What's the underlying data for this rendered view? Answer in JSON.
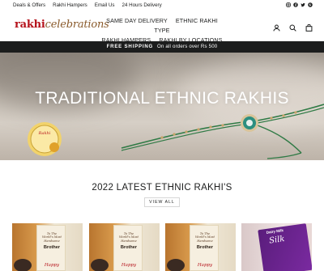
{
  "utility_bar": {
    "links": [
      "Deals & Offers",
      "Rakhi Hampers",
      "Email Us",
      "24 Hours Delivery"
    ],
    "social_icons": [
      "instagram-icon",
      "facebook-icon",
      "twitter-icon",
      "pinterest-icon"
    ]
  },
  "header": {
    "logo_prefix": "rakhi",
    "logo_suffix": "celebrations",
    "nav": [
      "SAME DAY DELIVERY",
      "ETHNIC RAKHI",
      "TYPE",
      "RAKHI HAMPERS",
      "RAKHI BY LOCATIONS"
    ],
    "icons": [
      "user-icon",
      "search-icon",
      "cart-icon"
    ]
  },
  "announcement": {
    "bold": "FREE SHIPPING",
    "text": "On all orders over Rs 500"
  },
  "hero": {
    "title": "TRADITIONAL ETHNIC RAKHIS"
  },
  "section": {
    "title": "2022 LATEST ETHNIC RAKHI'S",
    "button": "VIEW ALL"
  },
  "products": [
    {
      "line1": "To The",
      "line2": "World's Most",
      "line3": "Handsome",
      "name": "Brother",
      "footer": "Happy"
    },
    {
      "line1": "To The",
      "line2": "World's Most",
      "line3": "Handsome",
      "name": "Brother",
      "footer": "Happy"
    },
    {
      "line1": "To The",
      "line2": "World's Most",
      "line3": "Handsome",
      "name": "Brother",
      "footer": "Happy"
    },
    {
      "brand": "Dairy Milk",
      "name": "Silk"
    }
  ],
  "colors": {
    "brand_red": "#b5121b",
    "announcement_bg": "#1c1d1d"
  }
}
